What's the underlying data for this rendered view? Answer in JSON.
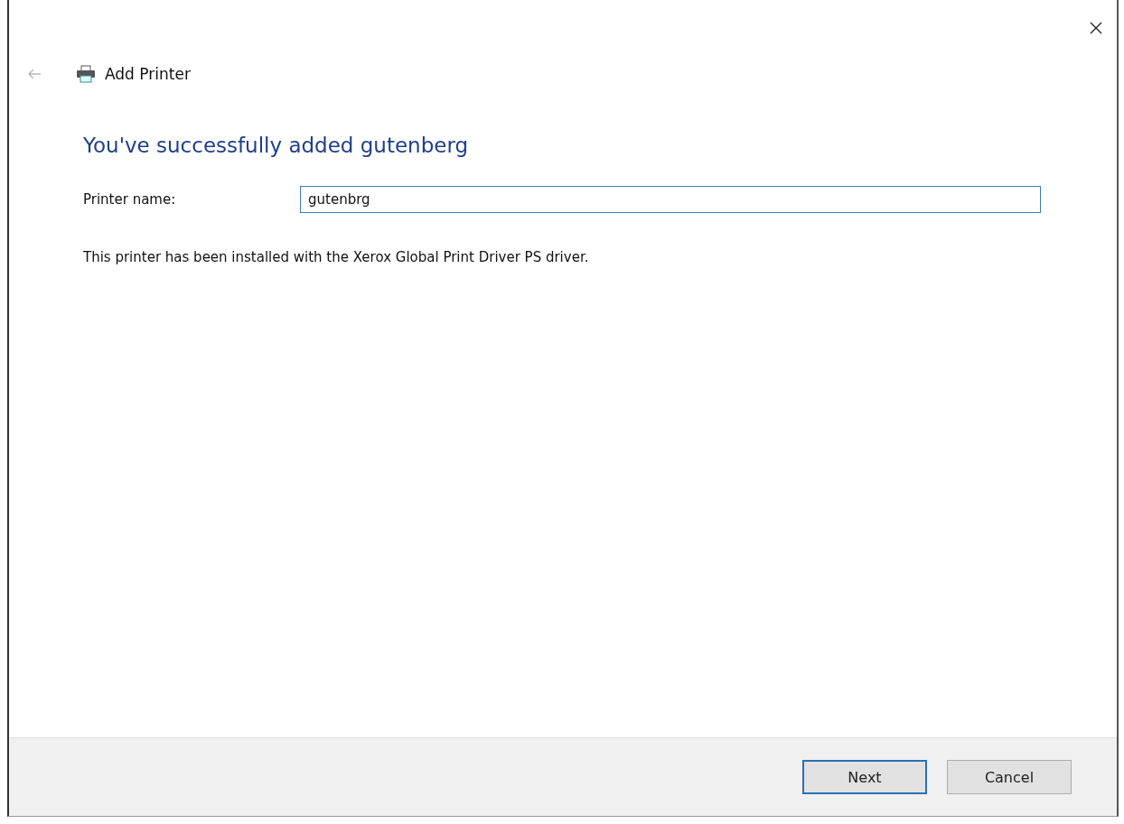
{
  "window": {
    "title": "Add Printer",
    "back_disabled": true
  },
  "heading": "You've successfully added gutenberg",
  "printer_name": {
    "label": "Printer name:",
    "value": "gutenbrg"
  },
  "message": "This printer has been installed with the Xerox Global Print Driver PS driver.",
  "buttons": [
    {
      "label": "Next",
      "default": true
    },
    {
      "label": "Cancel",
      "default": false
    }
  ]
}
